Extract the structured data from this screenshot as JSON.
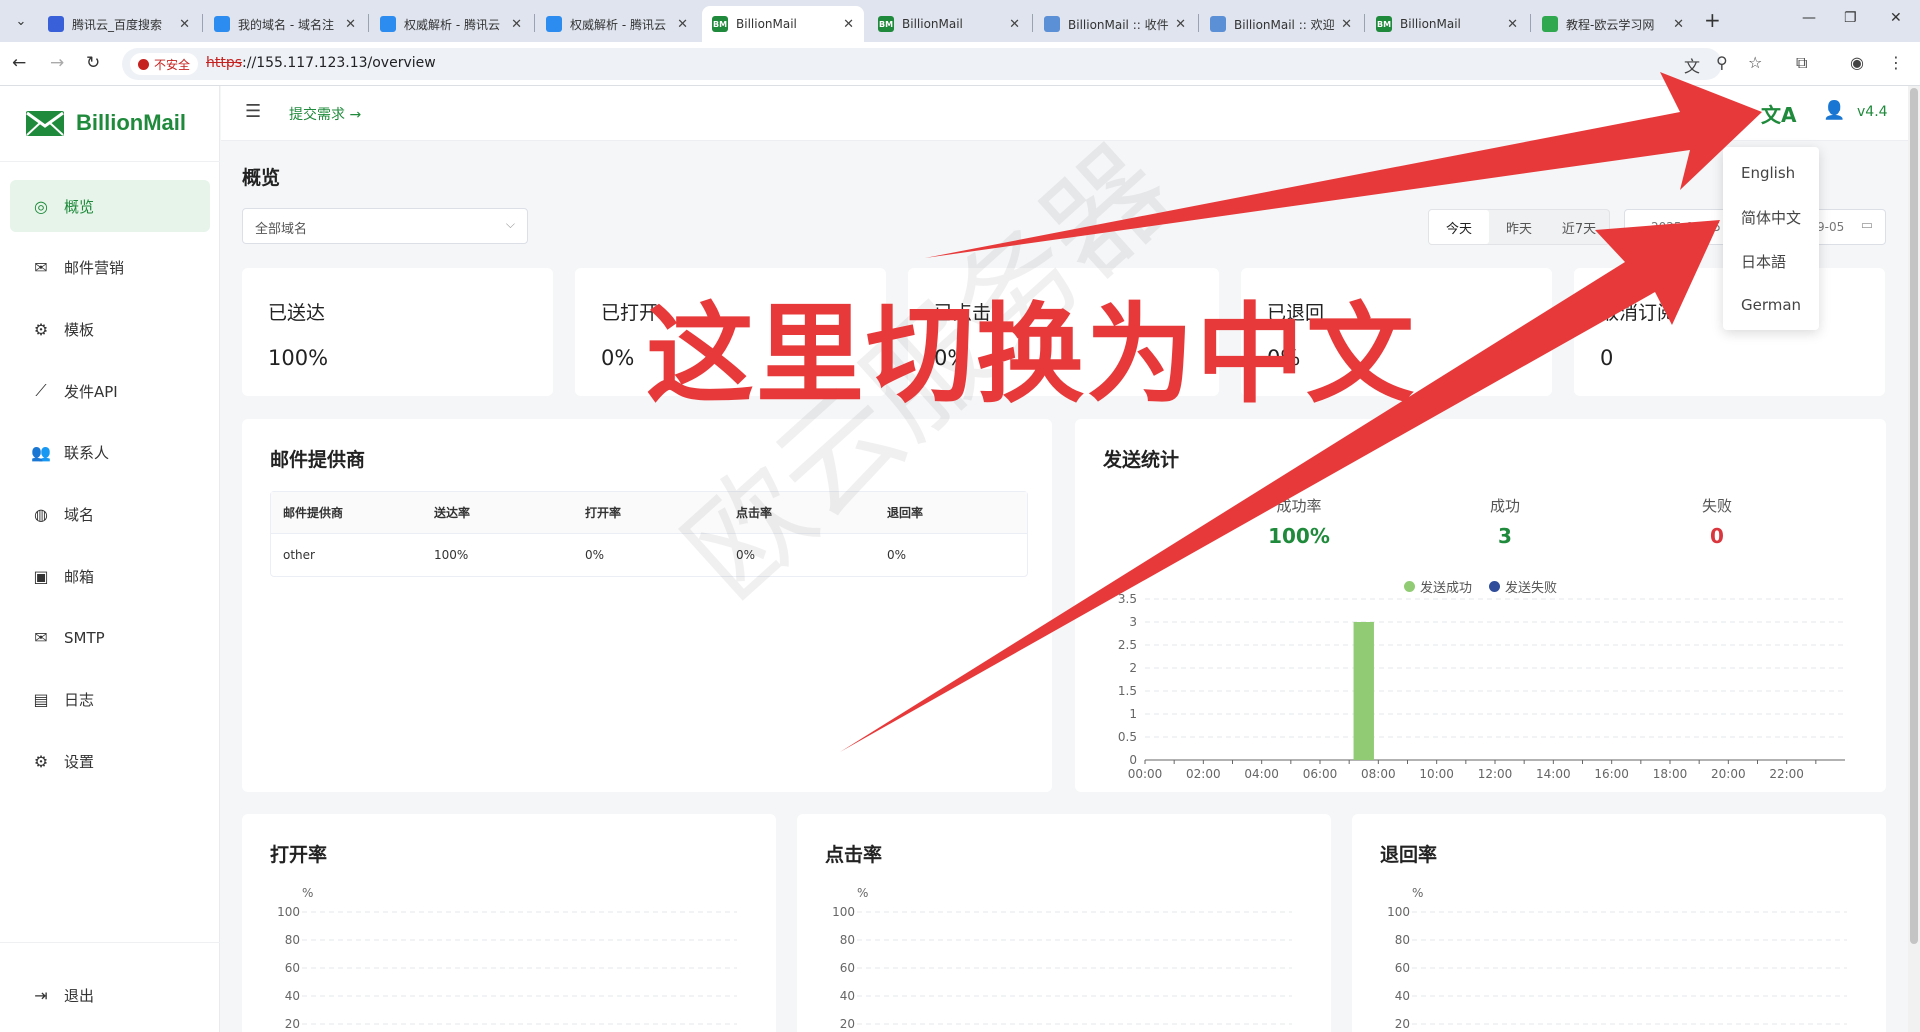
{
  "browser": {
    "tabs": [
      {
        "title": "腾讯云_百度搜索",
        "fav_color": "#3a60d9",
        "fav_text": "",
        "active": false
      },
      {
        "title": "我的域名 - 域名注",
        "fav_color": "#2d8cf0",
        "fav_text": "",
        "active": false
      },
      {
        "title": "权威解析 - 腾讯云",
        "fav_color": "#2d8cf0",
        "fav_text": "",
        "active": false
      },
      {
        "title": "权威解析 - 腾讯云",
        "fav_color": "#2d8cf0",
        "fav_text": "",
        "active": false
      },
      {
        "title": "BillionMail",
        "fav_color": "#1f8a3b",
        "fav_text": "BM",
        "active": true
      },
      {
        "title": "BillionMail",
        "fav_color": "#1f8a3b",
        "fav_text": "BM",
        "active": false
      },
      {
        "title": "BillionMail :: 收件",
        "fav_color": "#5b8fd6",
        "fav_text": "",
        "active": false
      },
      {
        "title": "BillionMail :: 欢迎",
        "fav_color": "#5b8fd6",
        "fav_text": "",
        "active": false
      },
      {
        "title": "BillionMail",
        "fav_color": "#1f8a3b",
        "fav_text": "BM",
        "active": false
      },
      {
        "title": "教程-欧云学习网",
        "fav_color": "#2fa84f",
        "fav_text": "",
        "active": false
      }
    ],
    "insecure_label": "不安全",
    "url_proto": "https",
    "url_rest": "://155.117.123.13/overview"
  },
  "sidebar": {
    "brand": "BillionMail",
    "items": [
      {
        "label": "概览",
        "icon": "globe-icon",
        "glyph": "◎",
        "active": true
      },
      {
        "label": "邮件营销",
        "icon": "mail-list-icon",
        "glyph": "✉",
        "active": false
      },
      {
        "label": "模板",
        "icon": "gear-icon",
        "glyph": "⚙",
        "active": false
      },
      {
        "label": "发件API",
        "icon": "chart-icon",
        "glyph": "⟋",
        "active": false
      },
      {
        "label": "联系人",
        "icon": "contacts-icon",
        "glyph": "👥",
        "active": false
      },
      {
        "label": "域名",
        "icon": "globe-icon",
        "glyph": "◍",
        "active": false
      },
      {
        "label": "邮箱",
        "icon": "mailbox-icon",
        "glyph": "▣",
        "active": false
      },
      {
        "label": "SMTP",
        "icon": "smtp-icon",
        "glyph": "✉",
        "active": false
      },
      {
        "label": "日志",
        "icon": "log-icon",
        "glyph": "▤",
        "active": false
      },
      {
        "label": "设置",
        "icon": "settings-icon",
        "glyph": "⚙",
        "active": false
      }
    ],
    "logout": "退出"
  },
  "header": {
    "submit": "提交需求 →",
    "version": "v4.4"
  },
  "main": {
    "title": "概览",
    "domain_select": "全部域名",
    "ranges": [
      "今天",
      "昨天",
      "近7天"
    ],
    "active_range": 0,
    "date_start": "2025-09-05",
    "date_end": "9-05"
  },
  "stats": [
    {
      "label": "已送达",
      "value": "100%"
    },
    {
      "label": "已打开",
      "value": "0%"
    },
    {
      "label": "已点击",
      "value": "0%"
    },
    {
      "label": "已退回",
      "value": "0%"
    },
    {
      "label": "取消订阅",
      "value": "0"
    }
  ],
  "providers": {
    "title": "邮件提供商",
    "columns": [
      "邮件提供商",
      "送达率",
      "打开率",
      "点击率",
      "退回率"
    ],
    "rows": [
      [
        "other",
        "100%",
        "0%",
        "0%",
        "0%"
      ]
    ]
  },
  "send_stats": {
    "title": "发送统计",
    "summary": [
      {
        "label": "成功率",
        "value": "100%",
        "color": "#1f8a3b"
      },
      {
        "label": "成功",
        "value": "3",
        "color": "#1f8a3b"
      },
      {
        "label": "失败",
        "value": "0",
        "color": "#d9363e"
      }
    ],
    "legend": [
      {
        "name": "发送成功",
        "color": "#91cc75"
      },
      {
        "name": "发送失败",
        "color": "#2f4d9a"
      }
    ]
  },
  "bottom_charts": [
    {
      "title": "打开率",
      "unit": "%"
    },
    {
      "title": "点击率",
      "unit": "%"
    },
    {
      "title": "退回率",
      "unit": "%"
    }
  ],
  "lang_menu": [
    "English",
    "简体中文",
    "日本語",
    "German"
  ],
  "annotation": "这里切换为中文",
  "watermark": "欧云服务器",
  "chart_data": [
    {
      "type": "bar",
      "title": "发送统计",
      "x": [
        "00:00",
        "01:00",
        "02:00",
        "03:00",
        "04:00",
        "05:00",
        "06:00",
        "07:00",
        "08:00",
        "09:00",
        "10:00",
        "11:00",
        "12:00",
        "13:00",
        "14:00",
        "15:00",
        "16:00",
        "17:00",
        "18:00",
        "19:00",
        "20:00",
        "21:00",
        "22:00",
        "23:00"
      ],
      "x_tick_labels": [
        "00:00",
        "02:00",
        "04:00",
        "06:00",
        "08:00",
        "10:00",
        "12:00",
        "14:00",
        "16:00",
        "18:00",
        "20:00",
        "22:00"
      ],
      "series": [
        {
          "name": "发送成功",
          "color": "#91cc75",
          "values": [
            0,
            0,
            0,
            0,
            0,
            0,
            0,
            3,
            0,
            0,
            0,
            0,
            0,
            0,
            0,
            0,
            0,
            0,
            0,
            0,
            0,
            0,
            0,
            0
          ]
        },
        {
          "name": "发送失败",
          "color": "#2f4d9a",
          "values": [
            0,
            0,
            0,
            0,
            0,
            0,
            0,
            0,
            0,
            0,
            0,
            0,
            0,
            0,
            0,
            0,
            0,
            0,
            0,
            0,
            0,
            0,
            0,
            0
          ]
        }
      ],
      "y_ticks": [
        "0",
        "0.5",
        "1",
        "1.5",
        "2",
        "2.5",
        "3",
        "3.5"
      ],
      "ylim": [
        0,
        3.5
      ]
    },
    {
      "type": "line",
      "title": "打开率",
      "ylabel": "%",
      "y_ticks": [
        "100",
        "80",
        "60",
        "40",
        "20"
      ],
      "ylim": [
        0,
        100
      ],
      "series": []
    },
    {
      "type": "line",
      "title": "点击率",
      "ylabel": "%",
      "y_ticks": [
        "100",
        "80",
        "60",
        "40",
        "20"
      ],
      "ylim": [
        0,
        100
      ],
      "series": []
    },
    {
      "type": "line",
      "title": "退回率",
      "ylabel": "%",
      "y_ticks": [
        "100",
        "80",
        "60",
        "40",
        "20"
      ],
      "ylim": [
        0,
        100
      ],
      "series": []
    }
  ]
}
